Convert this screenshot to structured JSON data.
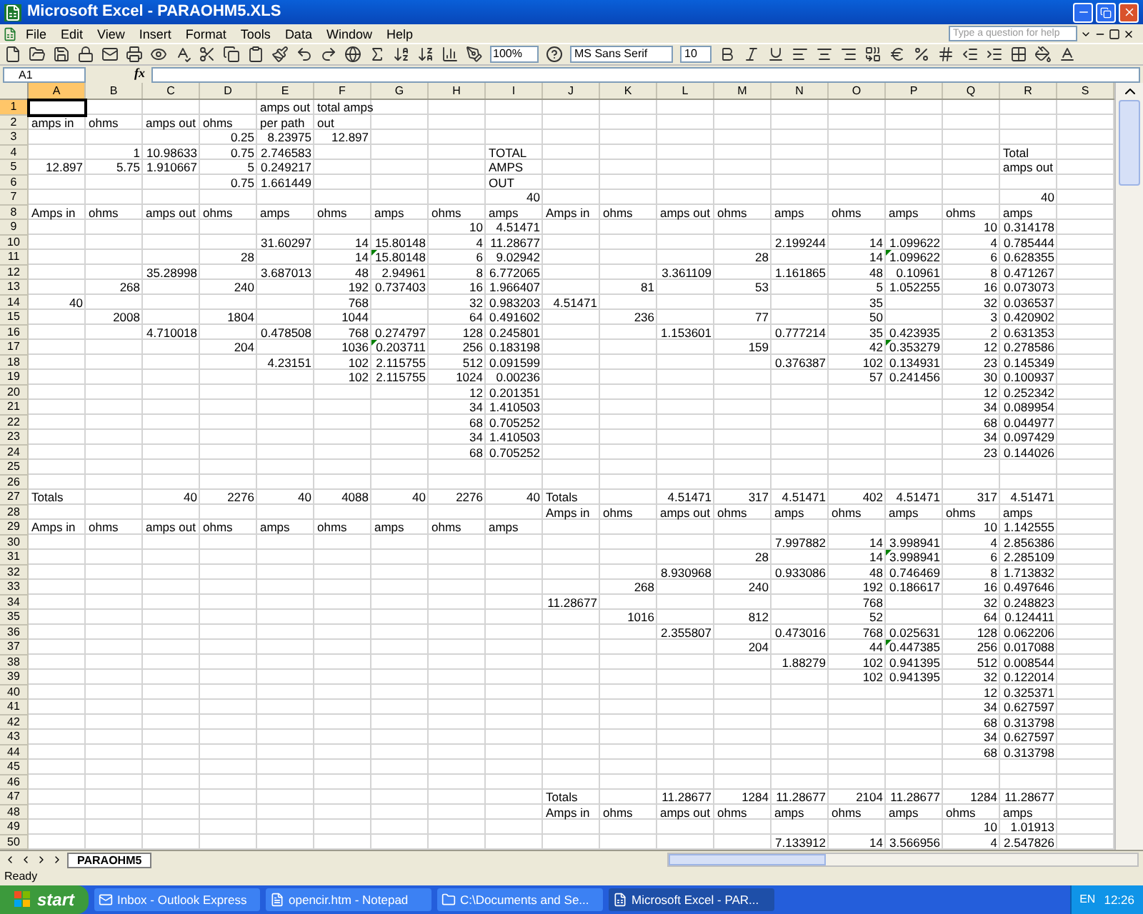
{
  "window": {
    "title": "Microsoft Excel - PARAOHM5.XLS"
  },
  "menus": [
    "File",
    "Edit",
    "View",
    "Insert",
    "Format",
    "Tools",
    "Data",
    "Window",
    "Help"
  ],
  "help_box": {
    "placeholder": "Type a question for help"
  },
  "toolbar": {
    "zoom": "100%",
    "font": "MS Sans Serif",
    "size": "10"
  },
  "name_box": "A1",
  "formula_icon": "fx",
  "columns": [
    "A",
    "B",
    "C",
    "D",
    "E",
    "F",
    "G",
    "H",
    "I",
    "J",
    "K",
    "L",
    "M",
    "N",
    "O",
    "P",
    "Q",
    "R",
    "S"
  ],
  "rows": [
    {
      "n": "1",
      "active": {
        "A": true
      },
      "txt": {
        "E": "amps out",
        "F": "total amps"
      }
    },
    {
      "n": "2",
      "txt": {
        "A": "amps in",
        "B": "ohms",
        "C": "amps out",
        "D": "ohms",
        "E": "per path",
        "F": "out"
      }
    },
    {
      "n": "3",
      "num": {
        "D": "0.25",
        "E": "8.23975",
        "F": "12.897"
      }
    },
    {
      "n": "4",
      "num": {
        "B": "1",
        "C": "10.98633",
        "D": "0.75",
        "E": "2.746583"
      },
      "txt": {
        "I": "TOTAL",
        "R": "Total"
      }
    },
    {
      "n": "5",
      "num": {
        "A": "12.897",
        "B": "5.75",
        "C": "1.910667",
        "D": "5",
        "E": "0.249217"
      },
      "txt": {
        "I": "AMPS",
        "R": "amps out"
      }
    },
    {
      "n": "6",
      "num": {
        "D": "0.75",
        "E": "1.661449"
      },
      "txt": {
        "I": "OUT"
      }
    },
    {
      "n": "7",
      "num": {
        "I": "40",
        "R": "40"
      }
    },
    {
      "n": "8",
      "txt": {
        "A": "Amps in",
        "B": "ohms",
        "C": "amps out",
        "D": "ohms",
        "E": "amps",
        "F": "ohms",
        "G": "amps",
        "H": "ohms",
        "I": "amps",
        "J": "Amps in",
        "K": "ohms",
        "L": "amps out",
        "M": "ohms",
        "N": "amps",
        "O": "ohms",
        "P": "amps",
        "Q": "ohms",
        "R": "amps"
      }
    },
    {
      "n": "9",
      "num": {
        "H": "10",
        "I": "4.51471",
        "Q": "10",
        "R": "0.314178"
      }
    },
    {
      "n": "10",
      "num": {
        "E": "31.60297",
        "F": "14",
        "G": "15.80148",
        "H": "4",
        "I": "11.28677",
        "N": "2.199244",
        "O": "14",
        "P": "1.099622",
        "Q": "4",
        "R": "0.785444"
      }
    },
    {
      "n": "11",
      "num": {
        "D": "28",
        "F": "14",
        "G": "15.80148",
        "H": "6",
        "I": "9.02942",
        "M": "28",
        "O": "14",
        "P": "1.099622",
        "Q": "6",
        "R": "0.628355"
      },
      "flag": {
        "G": true,
        "P": true
      }
    },
    {
      "n": "12",
      "num": {
        "C": "35.28998",
        "E": "3.687013",
        "F": "48",
        "G": "2.94961",
        "H": "8",
        "I": "6.772065",
        "L": "3.361109",
        "N": "1.161865",
        "O": "48",
        "P": "0.10961",
        "Q": "8",
        "R": "0.471267"
      }
    },
    {
      "n": "13",
      "num": {
        "B": "268",
        "D": "240",
        "F": "192",
        "G": "0.737403",
        "H": "16",
        "I": "1.966407",
        "K": "81",
        "M": "53",
        "O": "5",
        "P": "1.052255",
        "Q": "16",
        "R": "0.073073"
      }
    },
    {
      "n": "14",
      "num": {
        "A": "40",
        "F": "768",
        "H": "32",
        "I": "0.983203",
        "J": "4.51471",
        "O": "35",
        "Q": "32",
        "R": "0.036537"
      }
    },
    {
      "n": "15",
      "num": {
        "B": "2008",
        "D": "1804",
        "F": "1044",
        "H": "64",
        "I": "0.491602",
        "K": "236",
        "M": "77",
        "O": "50",
        "Q": "3",
        "R": "0.420902"
      }
    },
    {
      "n": "16",
      "num": {
        "C": "4.710018",
        "E": "0.478508",
        "F": "768",
        "G": "0.274797",
        "H": "128",
        "I": "0.245801",
        "L": "1.153601",
        "N": "0.777214",
        "O": "35",
        "P": "0.423935",
        "Q": "2",
        "R": "0.631353"
      }
    },
    {
      "n": "17",
      "num": {
        "D": "204",
        "F": "1036",
        "G": "0.203711",
        "H": "256",
        "I": "0.183198",
        "M": "159",
        "O": "42",
        "P": "0.353279",
        "Q": "12",
        "R": "0.278586"
      },
      "flag": {
        "G": true,
        "P": true
      }
    },
    {
      "n": "18",
      "num": {
        "E": "4.23151",
        "F": "102",
        "G": "2.115755",
        "H": "512",
        "I": "0.091599",
        "N": "0.376387",
        "O": "102",
        "P": "0.134931",
        "Q": "23",
        "R": "0.145349"
      }
    },
    {
      "n": "19",
      "num": {
        "F": "102",
        "G": "2.115755",
        "H": "1024",
        "I": "0.00236",
        "O": "57",
        "P": "0.241456",
        "Q": "30",
        "R": "0.100937"
      }
    },
    {
      "n": "20",
      "num": {
        "H": "12",
        "I": "0.201351",
        "Q": "12",
        "R": "0.252342"
      }
    },
    {
      "n": "21",
      "num": {
        "H": "34",
        "I": "1.410503",
        "Q": "34",
        "R": "0.089954"
      }
    },
    {
      "n": "22",
      "num": {
        "H": "68",
        "I": "0.705252",
        "Q": "68",
        "R": "0.044977"
      }
    },
    {
      "n": "23",
      "num": {
        "H": "34",
        "I": "1.410503",
        "Q": "34",
        "R": "0.097429"
      }
    },
    {
      "n": "24",
      "num": {
        "H": "68",
        "I": "0.705252",
        "Q": "23",
        "R": "0.144026"
      }
    },
    {
      "n": "25"
    },
    {
      "n": "26"
    },
    {
      "n": "27",
      "txt": {
        "A": "Totals",
        "J": "Totals"
      },
      "num": {
        "C": "40",
        "D": "2276",
        "E": "40",
        "F": "4088",
        "G": "40",
        "H": "2276",
        "I": "40",
        "L": "4.51471",
        "M": "317",
        "N": "4.51471",
        "O": "402",
        "P": "4.51471",
        "Q": "317",
        "R": "4.51471"
      }
    },
    {
      "n": "28",
      "txt": {
        "J": "Amps in",
        "K": "ohms",
        "L": "amps out",
        "M": "ohms",
        "N": "amps",
        "O": "ohms",
        "P": "amps",
        "Q": "ohms",
        "R": "amps"
      }
    },
    {
      "n": "29",
      "txt": {
        "A": "Amps in",
        "B": "ohms",
        "C": "amps out",
        "D": "ohms",
        "E": "amps",
        "F": "ohms",
        "G": "amps",
        "H": "ohms",
        "I": "amps"
      },
      "num": {
        "Q": "10",
        "R": "1.142555"
      }
    },
    {
      "n": "30",
      "num": {
        "N": "7.997882",
        "O": "14",
        "P": "3.998941",
        "Q": "4",
        "R": "2.856386"
      }
    },
    {
      "n": "31",
      "num": {
        "M": "28",
        "O": "14",
        "P": "3.998941",
        "Q": "6",
        "R": "2.285109"
      },
      "flag": {
        "P": true
      }
    },
    {
      "n": "32",
      "num": {
        "L": "8.930968",
        "N": "0.933086",
        "O": "48",
        "P": "0.746469",
        "Q": "8",
        "R": "1.713832"
      }
    },
    {
      "n": "33",
      "num": {
        "K": "268",
        "M": "240",
        "O": "192",
        "P": "0.186617",
        "Q": "16",
        "R": "0.497646"
      }
    },
    {
      "n": "34",
      "num": {
        "J": "11.28677",
        "O": "768",
        "Q": "32",
        "R": "0.248823"
      }
    },
    {
      "n": "35",
      "num": {
        "K": "1016",
        "M": "812",
        "O": "52",
        "Q": "64",
        "R": "0.124411"
      }
    },
    {
      "n": "36",
      "num": {
        "L": "2.355807",
        "N": "0.473016",
        "O": "768",
        "P": "0.025631",
        "Q": "128",
        "R": "0.062206"
      }
    },
    {
      "n": "37",
      "num": {
        "M": "204",
        "O": "44",
        "P": "0.447385",
        "Q": "256",
        "R": "0.017088"
      },
      "flag": {
        "P": true
      }
    },
    {
      "n": "38",
      "num": {
        "N": "1.88279",
        "O": "102",
        "P": "0.941395",
        "Q": "512",
        "R": "0.008544"
      }
    },
    {
      "n": "39",
      "num": {
        "O": "102",
        "P": "0.941395",
        "Q": "32",
        "R": "0.122014"
      }
    },
    {
      "n": "40",
      "num": {
        "Q": "12",
        "R": "0.325371"
      }
    },
    {
      "n": "41",
      "num": {
        "Q": "34",
        "R": "0.627597"
      }
    },
    {
      "n": "42",
      "num": {
        "Q": "68",
        "R": "0.313798"
      }
    },
    {
      "n": "43",
      "num": {
        "Q": "34",
        "R": "0.627597"
      }
    },
    {
      "n": "44",
      "num": {
        "Q": "68",
        "R": "0.313798"
      }
    },
    {
      "n": "45"
    },
    {
      "n": "46"
    },
    {
      "n": "47",
      "txt": {
        "J": "Totals"
      },
      "num": {
        "L": "11.28677",
        "M": "1284",
        "N": "11.28677",
        "O": "2104",
        "P": "11.28677",
        "Q": "1284",
        "R": "11.28677"
      }
    },
    {
      "n": "48",
      "txt": {
        "J": "Amps in",
        "K": "ohms",
        "L": "amps out",
        "M": "ohms",
        "N": "amps",
        "O": "ohms",
        "P": "amps",
        "Q": "ohms",
        "R": "amps"
      }
    },
    {
      "n": "49",
      "num": {
        "Q": "10",
        "R": "1.01913"
      }
    },
    {
      "n": "50",
      "num": {
        "N": "7.133912",
        "O": "14",
        "P": "3.566956",
        "Q": "4",
        "R": "2.547826"
      }
    }
  ],
  "sheet_tabs": [
    {
      "label": "PARAOHM5",
      "selected": true
    }
  ],
  "status": "Ready",
  "taskbar": {
    "start": "start",
    "tasks": [
      {
        "label": "Inbox - Outlook Express",
        "selected": false
      },
      {
        "label": "opencir.htm - Notepad",
        "selected": false
      },
      {
        "label": "C:\\Documents and Se...",
        "selected": false
      },
      {
        "label": "Microsoft Excel - PAR...",
        "selected": true
      }
    ],
    "language": "EN",
    "clock": "12:26"
  }
}
